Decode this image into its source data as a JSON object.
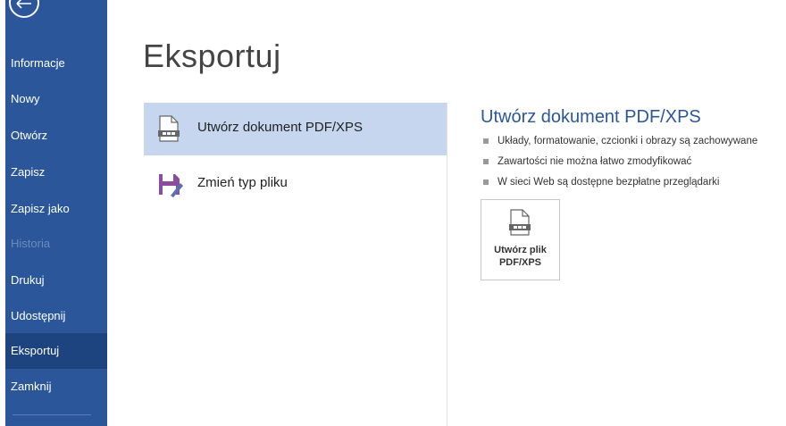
{
  "sidebar": {
    "items": [
      {
        "label": "Informacje"
      },
      {
        "label": "Nowy"
      },
      {
        "label": "Otwórz"
      },
      {
        "label": "Zapisz"
      },
      {
        "label": "Zapisz jako"
      },
      {
        "label": "Historia"
      },
      {
        "label": "Drukuj"
      },
      {
        "label": "Udostępnij"
      },
      {
        "label": "Eksportuj"
      },
      {
        "label": "Zamknij"
      }
    ],
    "disabled_item": "Historia",
    "selected_item": "Eksportuj",
    "color": "#2b579a",
    "selected_color": "#1e4480"
  },
  "main": {
    "title": "Eksportuj",
    "options": [
      {
        "label": "Utwórz dokument PDF/XPS",
        "icon": "pdf-document-icon",
        "selected": true
      },
      {
        "label": "Zmień typ pliku",
        "icon": "save-as-icon",
        "selected": false
      }
    ]
  },
  "detail": {
    "title": "Utwórz dokument PDF/XPS",
    "bullets": [
      "Układy, formatowanie, czcionki i obrazy są zachowywane",
      "Zawartości nie można łatwo zmodyfikować",
      "W sieci Web są dostępne bezpłatne przeglądarki"
    ],
    "button_line1": "Utwórz plik",
    "button_line2": "PDF/XPS"
  }
}
